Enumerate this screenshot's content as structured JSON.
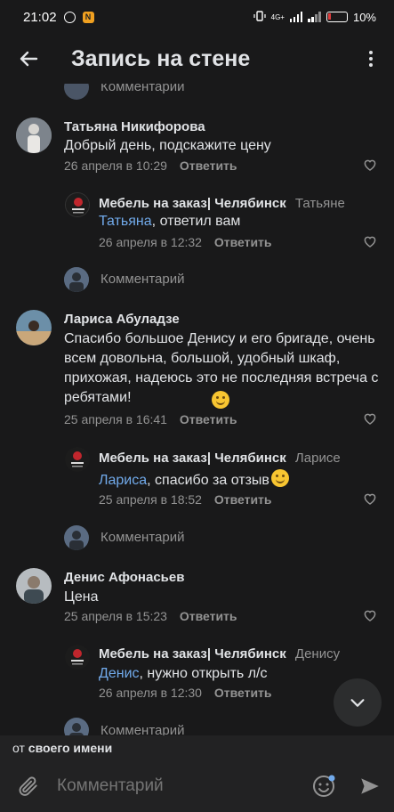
{
  "status": {
    "time": "21:02",
    "notif_badge": "N",
    "network": "4G+",
    "battery": "10%"
  },
  "header": {
    "title": "Запись на стене"
  },
  "top_partial": {
    "comment_label": "Комментарий"
  },
  "threads": [
    {
      "author": "Татьяна Никифорова",
      "text": "Добрый день, подскажите  цену",
      "date": "26 апреля в 10:29",
      "reply_label": "Ответить",
      "reply": {
        "author": "Мебель на заказ| Челябинск",
        "to": "Татьяне",
        "mention": "Татьяна",
        "text": ", ответил вам",
        "date": "26 апреля в 12:32",
        "reply_label": "Ответить"
      },
      "comment_label": "Комментарий"
    },
    {
      "author": "Лариса Абуладзе",
      "text": "Спасибо большое Денису и его бригаде, очень всем довольна, большой, удобный шкаф, прихожая, надеюсь это не последняя встреча с ребятами!",
      "date": "25 апреля в 16:41",
      "reply_label": "Ответить",
      "reply": {
        "author": "Мебель на заказ| Челябинск",
        "to": "Ларисе",
        "mention": "Лариса",
        "text": ", спасибо за отзыв",
        "date": "25 апреля в 18:52",
        "reply_label": "Ответить"
      },
      "comment_label": "Комментарий"
    },
    {
      "author": "Денис Афонасьев",
      "text": "Цена",
      "date": "25 апреля в 15:23",
      "reply_label": "Ответить",
      "reply": {
        "author": "Мебель на заказ| Челябинск",
        "to": "Денису",
        "mention": "Денис",
        "text": ", нужно открыть л/с",
        "date": "26 апреля в 12:30",
        "reply_label": "Ответить"
      },
      "comment_label": "Комментарий"
    }
  ],
  "composer": {
    "from_prefix": "от",
    "from_name": "своего имени",
    "placeholder": "Комментарий"
  },
  "colors": {
    "background": "#19191a",
    "text": "#e1e3e6",
    "secondary": "#939393",
    "link": "#71aaeb"
  }
}
